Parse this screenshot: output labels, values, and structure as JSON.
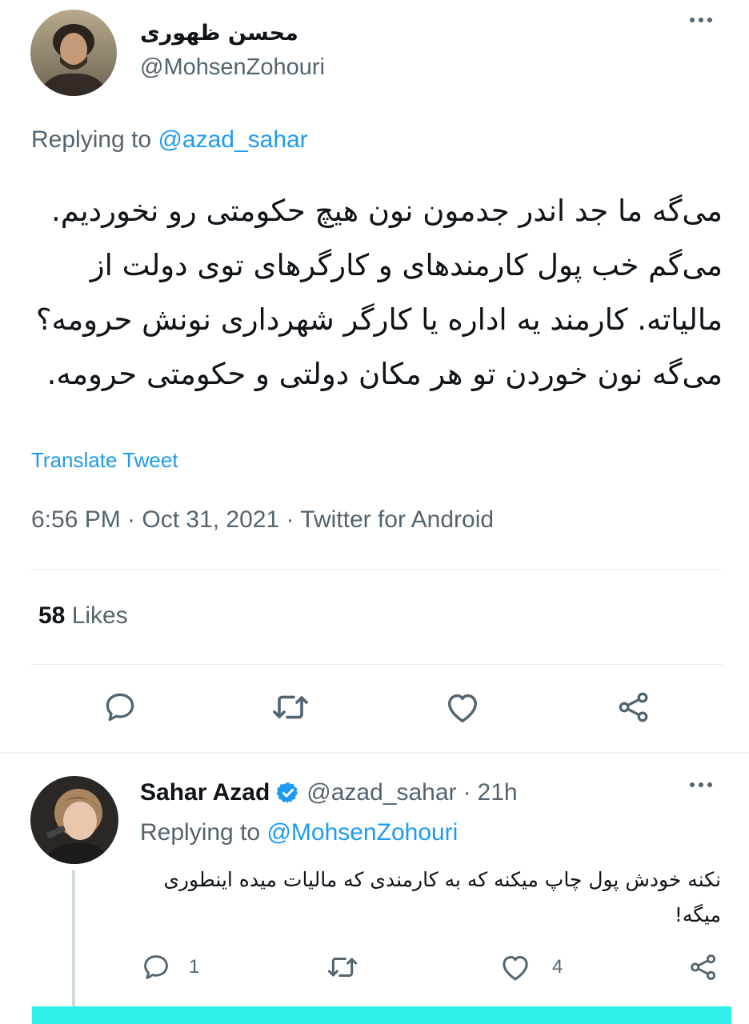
{
  "main_tweet": {
    "display_name": "محسن ظهوری",
    "handle": "@MohsenZohouri",
    "replying_prefix": "Replying to ",
    "replying_to": "@azad_sahar",
    "text": "می‌گه ما جد اندر جدمون نون هیچ حکومتی رو نخوردیم. می‌گم خب پول کارمندهای و کارگرهای توی دولت از مالیاته. کارمند یه اداره یا کارگر شهرداری نونش حرومه؟ می‌گه نون خوردن تو هر مکان دولتی و حکومتی حرومه.",
    "translate_label": "Translate Tweet",
    "meta": "6:56 PM · Oct 31, 2021 · Twitter for Android",
    "likes_count": "58",
    "likes_label": " Likes",
    "icons": [
      "more-icon",
      "reply-icon",
      "retweet-icon",
      "like-icon",
      "share-icon"
    ]
  },
  "reply_tweet": {
    "display_name": "Sahar Azad",
    "handle": "@azad_sahar",
    "separator": "·",
    "time": "21h",
    "replying_prefix": "Replying to ",
    "replying_to": "@MohsenZohouri",
    "text": "نکنه خودش پول چاپ میکنه که به کارمندی که مالیات میده اینطوری میگه!",
    "reply_count": "1",
    "like_count": "4",
    "icons": [
      "verified-badge-icon",
      "more-icon",
      "reply-icon",
      "retweet-icon",
      "like-icon",
      "share-icon"
    ]
  },
  "colors": {
    "accent": "#1d9bf0",
    "secondary_text": "#536471",
    "primary_text": "#0f1419",
    "bottom_bar": "#2ff0e8"
  }
}
